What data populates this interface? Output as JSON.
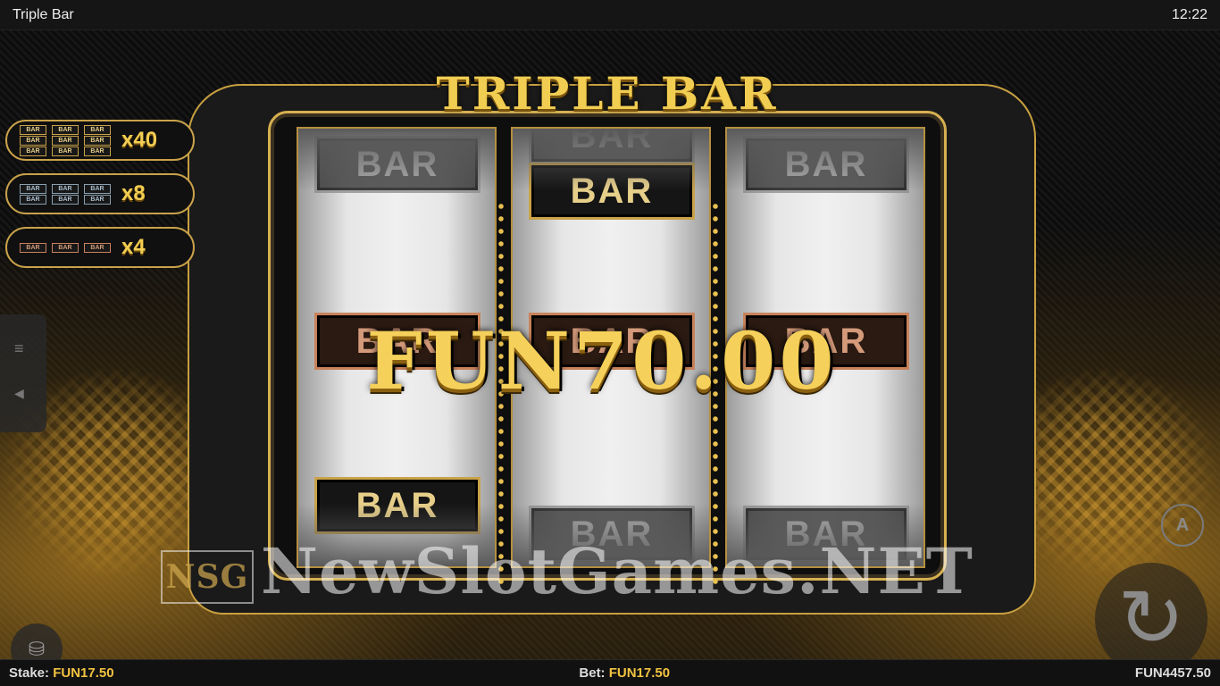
{
  "window": {
    "title": "Triple Bar",
    "clock": "12:22"
  },
  "game": {
    "logo": "TRIPLE BAR",
    "win_amount": "FUN70.00",
    "symbol_label": "BAR",
    "watermark": "NewSlotGames.NET",
    "watermark_logo": "NSG"
  },
  "paytable": [
    {
      "symbol": "triple-bar",
      "multiplier": "x40"
    },
    {
      "symbol": "double-bar",
      "multiplier": "x8"
    },
    {
      "symbol": "single-bar",
      "multiplier": "x4"
    }
  ],
  "footer": {
    "stake_label": "Stake:",
    "stake_value": "FUN17.50",
    "bet_label": "Bet:",
    "bet_value": "FUN17.50",
    "balance": "FUN4457.50"
  },
  "controls": {
    "menu_icon": "menu-icon",
    "sound_icon": "speaker-icon",
    "chips_icon": "coin-stack-icon",
    "spin_icon": "spin-arrow-icon",
    "autoplay_icon": "autoplay-icon",
    "autoplay_letter": "A"
  },
  "colors": {
    "gold": "#f1cd52",
    "accent_value": "#f3c341",
    "background": "#0c0c0c"
  }
}
